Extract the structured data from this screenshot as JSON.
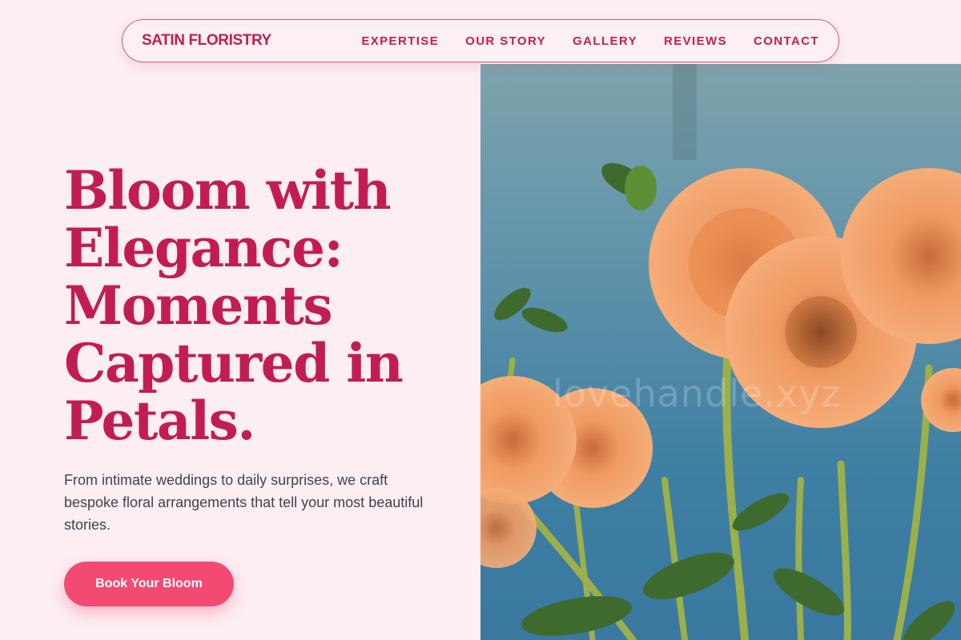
{
  "nav": {
    "brand": "SATIN FLORISTRY",
    "links": [
      "EXPERTISE",
      "OUR STORY",
      "GALLERY",
      "REVIEWS",
      "CONTACT"
    ]
  },
  "hero": {
    "headline": "Bloom with Elegance: Moments Captured in Petals.",
    "subtext": "From intimate weddings to daily surprises, we craft bespoke floral arrangements that tell your most beautiful stories.",
    "cta_label": "Book Your Bloom",
    "image_alt": "Orange dahlia flowers against a blue background",
    "watermark": "lovehandle.xyz"
  },
  "colors": {
    "background": "#fdeef1",
    "accent": "#c21d52",
    "cta": "#f24a72",
    "body_text": "#3e4452"
  }
}
